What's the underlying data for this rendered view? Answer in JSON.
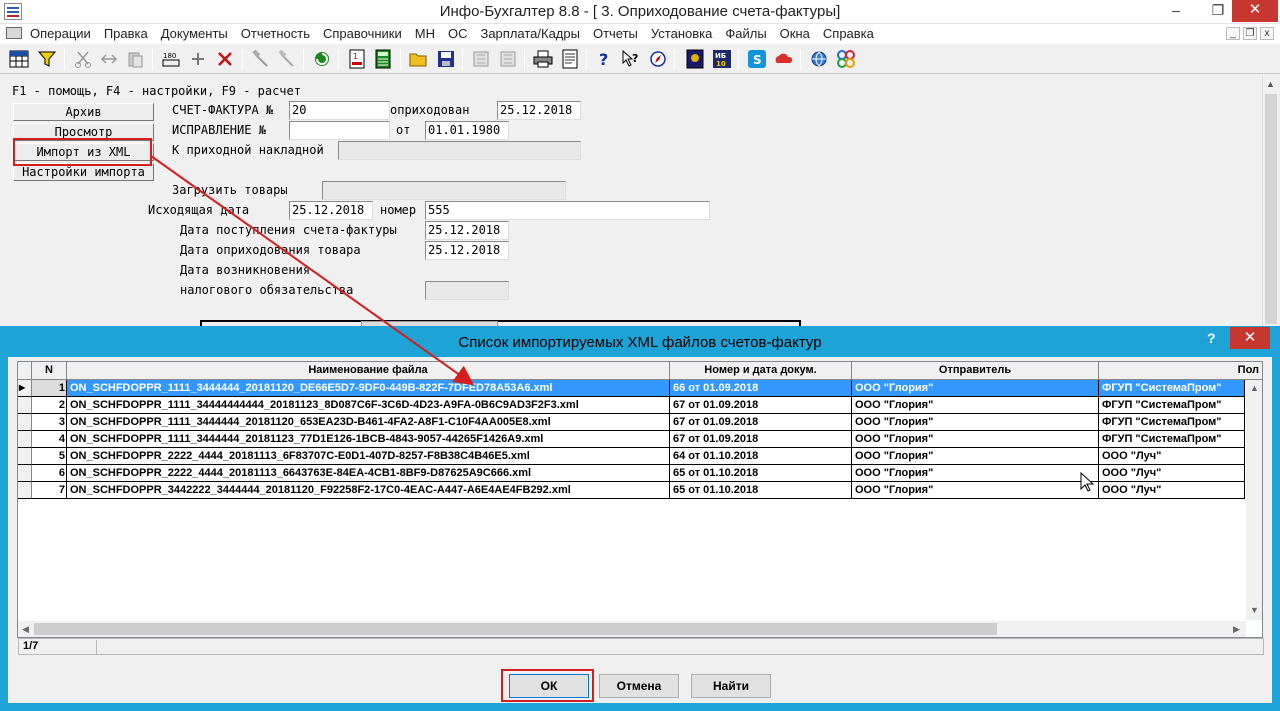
{
  "window": {
    "title": "Инфо-Бухгалтер 8.8 - [  3. Оприходование счета-фактуры]",
    "minimize_glyph": "–",
    "maximize_glyph": "❐",
    "close_glyph": "✕"
  },
  "menu": {
    "items": [
      "Операции",
      "Правка",
      "Документы",
      "Отчетность",
      "Справочники",
      "МН",
      "ОС",
      "Зарплата/Кадры",
      "Отчеты",
      "Установка",
      "Файлы",
      "Окна",
      "Справка"
    ],
    "mdi_min": "_",
    "mdi_restore": "❐",
    "mdi_close": "x"
  },
  "toolbar": {
    "icons": [
      "grid-icon",
      "filter-icon",
      "cut-icon",
      "move-icon",
      "paste-icon",
      "counter-icon",
      "plus-icon",
      "delete-icon",
      "hammer-icon",
      "hammer-disabled-icon",
      "refresh-icon",
      "calendar-doc-icon",
      "calculator-icon",
      "open-folder-icon",
      "save-icon",
      "disabled-doc-icon",
      "disabled-doc2-icon",
      "print-icon",
      "preview-icon",
      "help-icon",
      "context-help-icon",
      "compass-icon",
      "book-icon",
      "ib10-icon",
      "skype-icon",
      "cloud-icon",
      "globe-icon",
      "network-icon"
    ],
    "ib_label": "ИБ\n10"
  },
  "form": {
    "hint": "F1 - помощь, F4 - настройки, F9 - расчет",
    "buttons": {
      "archive": "Архив",
      "view": "Просмотр",
      "import_xml": "Импорт из XML",
      "import_settings": "Настройки импорта"
    },
    "invoice_label": "СЧЕТ-ФАКТУРА №",
    "invoice_number": "20",
    "posted_label": "оприходован",
    "posted_date": "25.12.2018",
    "correction_label": "ИСПРАВЛЕНИЕ  №",
    "correction_number": "",
    "from_label": "от",
    "correction_date": "01.01.1980",
    "receipt_label": "К приходной накладной",
    "receipt_value": "",
    "load_goods_label": "Загрузить товары",
    "load_goods_value": "",
    "outgoing_date_label": "Исходящая дата",
    "outgoing_date": "25.12.2018",
    "number_label": "номер",
    "outgoing_number": "555",
    "arrival_label": "Дата поступления счета-фактуры",
    "arrival_date": "25.12.2018",
    "posting_label": "Дата оприходования товара",
    "posting_date": "25.12.2018",
    "liability_label1": "Дата возникновения",
    "liability_label2": "налогового обязательства",
    "liability_value": ""
  },
  "dialog": {
    "title": "Список импортируемых XML файлов счетов-фактур",
    "help_glyph": "?",
    "close_glyph": "✕",
    "columns": [
      "N",
      "Наименование файла",
      "Номер и дата докум.",
      "Отправитель",
      "Пол"
    ],
    "rows": [
      {
        "n": "1",
        "file": "ON_SCHFDOPPR_1111_3444444_20181120_DE66E5D7-9DF0-449B-822F-7DFED78A53A6.xml",
        "doc": "66 от 01.09.2018",
        "sender": "ООО \"Глория\"",
        "receiver": "ФГУП \"СистемаПром\""
      },
      {
        "n": "2",
        "file": "ON_SCHFDOPPR_1111_34444444444_20181123_8D087C6F-3C6D-4D23-A9FA-0B6C9AD3F2F3.xml",
        "doc": "67 от 01.09.2018",
        "sender": "ООО \"Глория\"",
        "receiver": "ФГУП \"СистемаПром\""
      },
      {
        "n": "3",
        "file": "ON_SCHFDOPPR_1111_3444444_20181120_653EA23D-B461-4FA2-A8F1-C10F4AA005E8.xml",
        "doc": "67 от 01.09.2018",
        "sender": "ООО \"Глория\"",
        "receiver": "ФГУП \"СистемаПром\""
      },
      {
        "n": "4",
        "file": "ON_SCHFDOPPR_1111_3444444_20181123_77D1E126-1BCB-4843-9057-44265F1426A9.xml",
        "doc": "67 от 01.09.2018",
        "sender": "ООО \"Глория\"",
        "receiver": "ФГУП \"СистемаПром\""
      },
      {
        "n": "5",
        "file": "ON_SCHFDOPPR_2222_4444_20181113_6F83707C-E0D1-407D-8257-F8B38C4B46E5.xml",
        "doc": "64 от 01.10.2018",
        "sender": "ООО \"Глория\"",
        "receiver": "ООО \"Луч\""
      },
      {
        "n": "6",
        "file": "ON_SCHFDOPPR_2222_4444_20181113_6643763E-84EA-4CB1-8BF9-D87625A9C666.xml",
        "doc": "65 от 01.10.2018",
        "sender": "ООО \"Глория\"",
        "receiver": "ООО \"Луч\""
      },
      {
        "n": "7",
        "file": "ON_SCHFDOPPR_3442222_3444444_20181120_F92258F2-17C0-4EAC-A447-A6E4AE4FB292.xml",
        "doc": "65 от 01.10.2018",
        "sender": "ООО \"Глория\"",
        "receiver": "ООО \"Луч\""
      }
    ],
    "record_counter": "1/7",
    "ok_label": "ОК",
    "cancel_label": "Отмена",
    "find_label": "Найти",
    "row_indicator": "▶",
    "up_arrow": "▲",
    "down_arrow": "▼",
    "left_arrow": "◀",
    "right_arrow": "▶"
  },
  "colors": {
    "dialog_border": "#1ea3d6",
    "selection": "#3399ff",
    "highlight_red": "#d51f1f",
    "close_red": "#c7372f"
  }
}
